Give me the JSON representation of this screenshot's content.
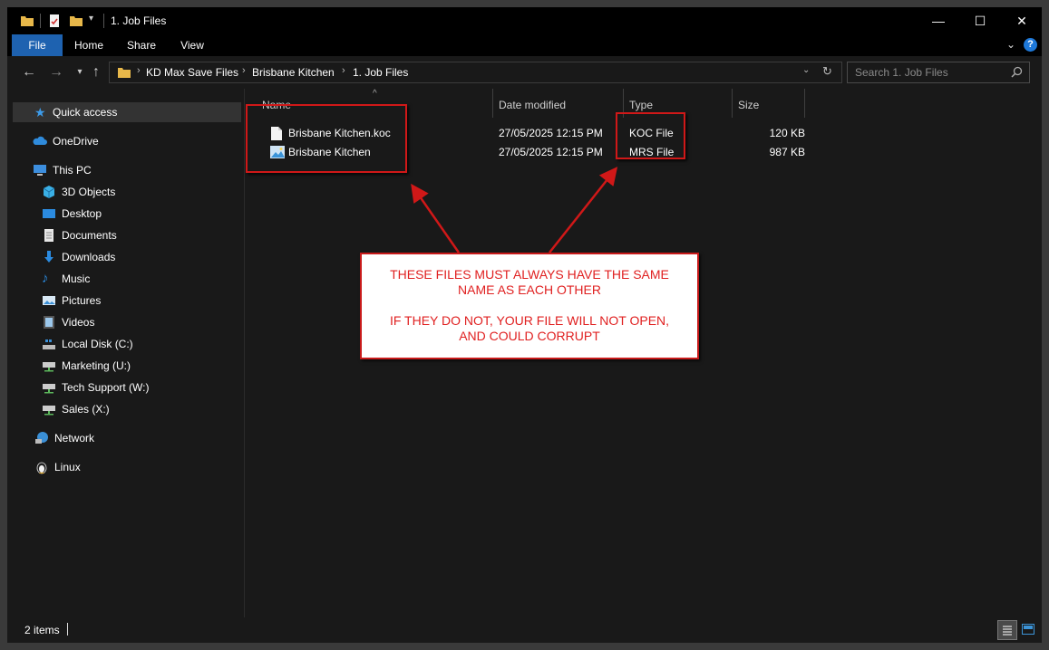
{
  "window": {
    "title": "1. Job Files",
    "controls": {
      "minimize": "—",
      "maximize": "☐",
      "close": "✕"
    }
  },
  "ribbon": {
    "tabs": [
      "File",
      "Home",
      "Share",
      "View"
    ],
    "help": "?"
  },
  "address": {
    "crumbs": [
      "KD Max Save Files",
      "Brisbane Kitchen",
      "1. Job Files"
    ],
    "search_placeholder": "Search 1. Job Files"
  },
  "nav": {
    "quick_access": "Quick access",
    "onedrive": "OneDrive",
    "this_pc": "This PC",
    "pc_items": [
      "3D Objects",
      "Desktop",
      "Documents",
      "Downloads",
      "Music",
      "Pictures",
      "Videos",
      "Local Disk (C:)",
      "Marketing (U:)",
      "Tech Support (W:)",
      "Sales (X:)"
    ],
    "network": "Network",
    "linux": "Linux"
  },
  "columns": {
    "name": "Name",
    "date": "Date modified",
    "type": "Type",
    "size": "Size"
  },
  "files": [
    {
      "name": "Brisbane Kitchen.koc",
      "date": "27/05/2025 12:15 PM",
      "type": "KOC File",
      "size": "120 KB",
      "icon": "document-icon"
    },
    {
      "name": "Brisbane Kitchen",
      "date": "27/05/2025 12:15 PM",
      "type": "MRS File",
      "size": "987 KB",
      "icon": "image-file-icon"
    }
  ],
  "status": {
    "items": "2 items"
  },
  "annotation": {
    "line1": "THESE FILES MUST ALWAYS HAVE THE SAME",
    "line2": "NAME AS EACH OTHER",
    "line3": "IF THEY DO NOT, YOUR FILE WILL NOT OPEN,",
    "line4": "AND COULD CORRUPT",
    "color": "#e02020"
  }
}
